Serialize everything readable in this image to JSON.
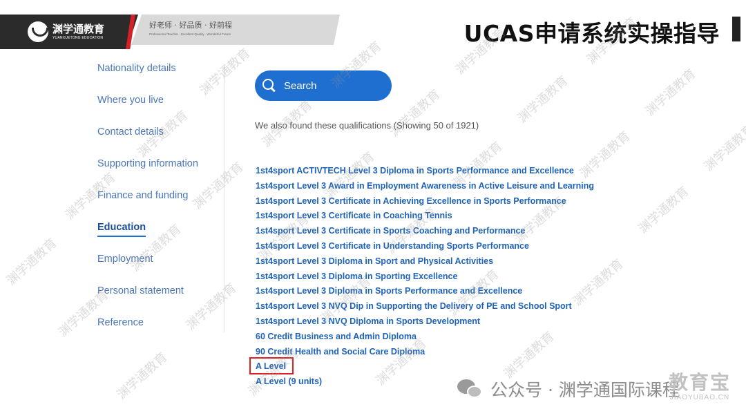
{
  "header": {
    "logo_cn": "渊学通教育",
    "logo_en": "YUANXUETONG EDUCATION",
    "slogan_cn": "好老师 · 好品质 · 好前程",
    "slogan_en": "Professional Teacher · Excellent Quality · Wonderful Future",
    "title": "UCAS申请系统实操指导"
  },
  "nav": {
    "items": [
      {
        "label": "Nationality details",
        "active": false
      },
      {
        "label": "Where you live",
        "active": false
      },
      {
        "label": "Contact details",
        "active": false
      },
      {
        "label": "Supporting information",
        "active": false
      },
      {
        "label": "Finance and funding",
        "active": false
      },
      {
        "label": "Education",
        "active": true
      },
      {
        "label": "Employment",
        "active": false
      },
      {
        "label": "Personal statement",
        "active": false
      },
      {
        "label": "Reference",
        "active": false
      }
    ]
  },
  "search": {
    "button_label": "Search",
    "icon": "search-icon",
    "button_color": "#1e6fcf"
  },
  "found_text": "We also found these qualifications (Showing 50 of 1921)",
  "results": [
    "1st4sport ACTIVTECH Level 3 Diploma in Sports Performance and Excellence",
    "1st4sport Level 3 Award in Employment Awareness in Active Leisure and Learning",
    "1st4sport Level 3 Certificate in Achieving Excellence in Sports Performance",
    "1st4sport Level 3 Certificate in Coaching Tennis",
    "1st4sport Level 3 Certificate in Sports Coaching and Performance",
    "1st4sport Level 3 Certificate in Understanding Sports Performance",
    "1st4sport Level 3 Diploma in Sport and Physical Activities",
    "1st4sport Level 3 Diploma in Sporting Excellence",
    "1st4sport Level 3 Diploma in Sports Performance and Excellence",
    "1st4sport Level 3 NVQ Dip in Supporting the Delivery of PE and School Sport",
    "1st4sport Level 3 NVQ Diploma in Sports Development",
    "60 Credit Business and Admin Diploma",
    "90 Credit Health and Social Care Diploma",
    "A Level",
    "A Level (9 units)"
  ],
  "highlighted_result": "A Level",
  "footer": {
    "wechat_text": "公众号 · 渊学通国际课程",
    "corner_cn": "教育宝",
    "corner_en": "JIAOYUBAO.CN"
  },
  "watermark_text": "渊学通教育",
  "colors": {
    "link": "#1e63b8",
    "nav_link": "#4a76b8",
    "highlight": "#e02020",
    "accent_red": "#d42027"
  }
}
